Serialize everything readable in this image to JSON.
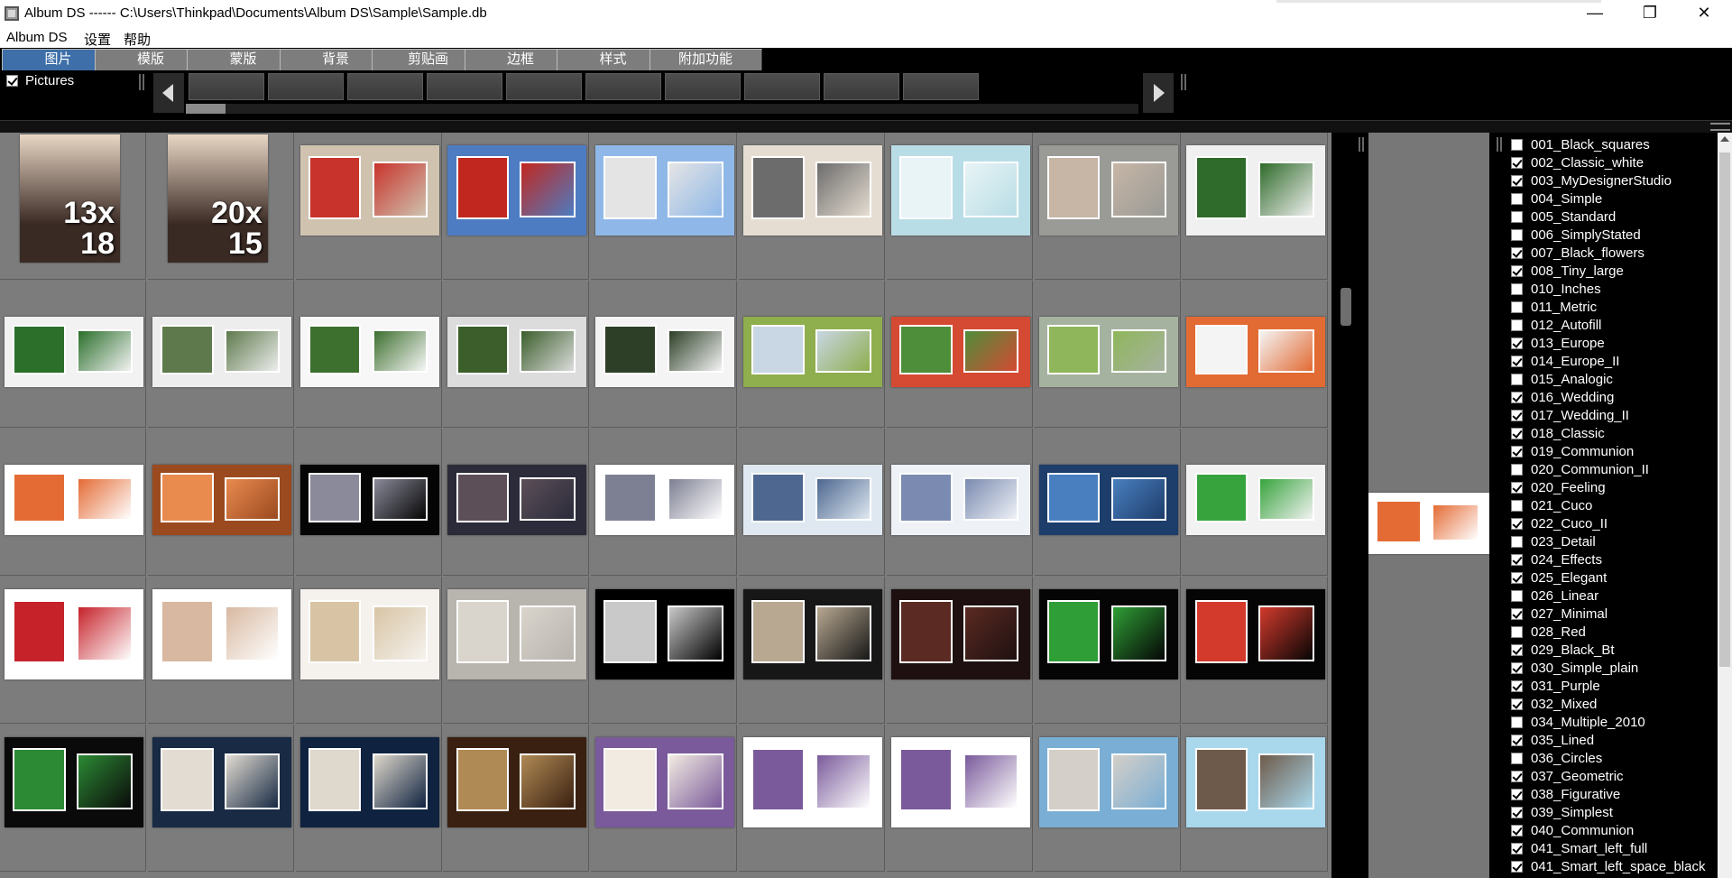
{
  "window": {
    "title": "Album DS ------   C:\\Users\\Thinkpad\\Documents\\Album DS\\Sample\\Sample.db",
    "min_glyph": "—",
    "max_glyph": "❐",
    "close_glyph": "✕"
  },
  "menu": [
    "Album DS",
    "设置",
    "帮助"
  ],
  "tabs": [
    {
      "label": "图片",
      "active": true
    },
    {
      "label": "模版",
      "active": false
    },
    {
      "label": "蒙版",
      "active": false
    },
    {
      "label": "背景",
      "active": false
    },
    {
      "label": "剪贴画",
      "active": false
    },
    {
      "label": "边框",
      "active": false
    },
    {
      "label": "样式",
      "active": false
    },
    {
      "label": "附加功能",
      "active": false
    }
  ],
  "filmstrip": {
    "pictures_label": "Pictures",
    "pictures_checked": true,
    "scroll_position": 0.0
  },
  "grid": {
    "rows": [
      [
        {
          "kind": "size",
          "label": "13x\n18",
          "bg": "#3a2a24",
          "fg": "#e9d7c5"
        },
        {
          "kind": "size",
          "label": "20x\n15",
          "bg": "#3a2a24",
          "fg": "#e9d7c5"
        },
        {
          "kind": "page",
          "bg": "#cfc3b0",
          "accent": "#c8332b"
        },
        {
          "kind": "page",
          "bg": "#4d7cc2",
          "accent": "#c2271f"
        },
        {
          "kind": "page",
          "bg": "#8fb8e8",
          "accent": "#e4e4e4"
        },
        {
          "kind": "page",
          "bg": "#e6ddd2",
          "accent": "#6c6c6c"
        },
        {
          "kind": "page",
          "bg": "#b9dde6",
          "accent": "#e8f4f6"
        },
        {
          "kind": "page",
          "bg": "#9a9a96",
          "accent": "#c7b6a6"
        },
        {
          "kind": "page",
          "bg": "#f0f0f0",
          "accent": "#2f6b2a"
        }
      ],
      [
        {
          "kind": "page",
          "bg": "#f2f2f2",
          "accent": "#2b6f2b"
        },
        {
          "kind": "page",
          "bg": "#ededed",
          "accent": "#5e7a4c"
        },
        {
          "kind": "page",
          "bg": "#f7f7f7",
          "accent": "#3d6f2e"
        },
        {
          "kind": "page",
          "bg": "#dcdcdc",
          "accent": "#3b5e2b"
        },
        {
          "kind": "page",
          "bg": "#f4f4f4",
          "accent": "#2d3f27"
        },
        {
          "kind": "page",
          "bg": "#8fae4e",
          "accent": "#c9d6e4"
        },
        {
          "kind": "page",
          "bg": "#d44a32",
          "accent": "#4e8d3a"
        },
        {
          "kind": "page",
          "bg": "#a6b2a0",
          "accent": "#8fb65a"
        },
        {
          "kind": "page",
          "bg": "#e26a33",
          "accent": "#f4f4f4"
        }
      ],
      [
        {
          "kind": "page",
          "bg": "#ffffff",
          "accent": "#e46b34"
        },
        {
          "kind": "page",
          "bg": "#9b4a1f",
          "accent": "#e98a4f"
        },
        {
          "kind": "page",
          "bg": "#050505",
          "accent": "#8a8a9a"
        },
        {
          "kind": "page",
          "bg": "#2b2b3a",
          "accent": "#5c4f58"
        },
        {
          "kind": "page",
          "bg": "#ffffff",
          "accent": "#7d7f92"
        },
        {
          "kind": "page",
          "bg": "#dfe8f0",
          "accent": "#4d6790"
        },
        {
          "kind": "page",
          "bg": "#eef1f6",
          "accent": "#7a8ab0"
        },
        {
          "kind": "page",
          "bg": "#1d3d6b",
          "accent": "#4a7fbf"
        },
        {
          "kind": "page",
          "bg": "#f2f2f2",
          "accent": "#37a33c"
        }
      ],
      [
        {
          "kind": "page",
          "bg": "#ffffff",
          "accent": "#c5222a"
        },
        {
          "kind": "page",
          "bg": "#ffffff",
          "accent": "#d8b8a0"
        },
        {
          "kind": "page",
          "bg": "#f5f2ee",
          "accent": "#d8c4a4"
        },
        {
          "kind": "page",
          "bg": "#b8b4ae",
          "accent": "#d9d4cc"
        },
        {
          "kind": "page",
          "bg": "#000000",
          "accent": "#c9c9c9"
        },
        {
          "kind": "page",
          "bg": "#171717",
          "accent": "#b8a892"
        },
        {
          "kind": "page",
          "bg": "#1e1010",
          "accent": "#5b2a22"
        },
        {
          "kind": "page",
          "bg": "#050505",
          "accent": "#2f9e36"
        },
        {
          "kind": "page",
          "bg": "#050505",
          "accent": "#d33a2c"
        }
      ],
      [
        {
          "kind": "page",
          "bg": "#0a0a0a",
          "accent": "#2c8a34"
        },
        {
          "kind": "page",
          "bg": "#182a44",
          "accent": "#e2dcd2"
        },
        {
          "kind": "page",
          "bg": "#0f2240",
          "accent": "#dfd8cc"
        },
        {
          "kind": "page",
          "bg": "#3a2010",
          "accent": "#b08a55"
        },
        {
          "kind": "page",
          "bg": "#7a5a9a",
          "accent": "#f2ebe2"
        },
        {
          "kind": "page",
          "bg": "#ffffff",
          "accent": "#7a5a9a"
        },
        {
          "kind": "page",
          "bg": "#ffffff",
          "accent": "#7a5a9a"
        },
        {
          "kind": "page",
          "bg": "#7aaed4",
          "accent": "#d4cfc8"
        },
        {
          "kind": "page",
          "bg": "#a9d8ec",
          "accent": "#6e5a4a"
        }
      ]
    ]
  },
  "preview": {
    "bg": "#ffffff",
    "accent": "#e46b34"
  },
  "grid_scroll_position": 0.22,
  "styles": [
    {
      "name": "001_Black_squares",
      "checked": false
    },
    {
      "name": "002_Classic_white",
      "checked": true
    },
    {
      "name": "003_MyDesignerStudio",
      "checked": true
    },
    {
      "name": "004_Simple",
      "checked": false
    },
    {
      "name": "005_Standard",
      "checked": false
    },
    {
      "name": "006_SimplyStated",
      "checked": false
    },
    {
      "name": "007_Black_flowers",
      "checked": true
    },
    {
      "name": "008_Tiny_large",
      "checked": true
    },
    {
      "name": "010_Inches",
      "checked": false
    },
    {
      "name": "011_Metric",
      "checked": false
    },
    {
      "name": "012_Autofill",
      "checked": false
    },
    {
      "name": "013_Europe",
      "checked": true
    },
    {
      "name": "014_Europe_II",
      "checked": true
    },
    {
      "name": "015_Analogic",
      "checked": false
    },
    {
      "name": "016_Wedding",
      "checked": true
    },
    {
      "name": "017_Wedding_II",
      "checked": true
    },
    {
      "name": "018_Classic",
      "checked": true
    },
    {
      "name": "019_Communion",
      "checked": true
    },
    {
      "name": "020_Communion_II",
      "checked": false
    },
    {
      "name": "020_Feeling",
      "checked": true
    },
    {
      "name": "021_Cuco",
      "checked": false
    },
    {
      "name": "022_Cuco_II",
      "checked": true
    },
    {
      "name": "023_Detail",
      "checked": false
    },
    {
      "name": "024_Effects",
      "checked": true
    },
    {
      "name": "025_Elegant",
      "checked": true
    },
    {
      "name": "026_Linear",
      "checked": false
    },
    {
      "name": "027_Minimal",
      "checked": true
    },
    {
      "name": "028_Red",
      "checked": false
    },
    {
      "name": "029_Black_Bt",
      "checked": true
    },
    {
      "name": "030_Simple_plain",
      "checked": true
    },
    {
      "name": "031_Purple",
      "checked": true
    },
    {
      "name": "032_Mixed",
      "checked": true
    },
    {
      "name": "034_Multiple_2010",
      "checked": false
    },
    {
      "name": "035_Lined",
      "checked": true
    },
    {
      "name": "036_Circles",
      "checked": false
    },
    {
      "name": "037_Geometric",
      "checked": true
    },
    {
      "name": "038_Figurative",
      "checked": true
    },
    {
      "name": "039_Simplest",
      "checked": true
    },
    {
      "name": "040_Communion",
      "checked": true
    },
    {
      "name": "041_Smart_left_full",
      "checked": true
    },
    {
      "name": "041_Smart_left_space_black",
      "checked": true
    }
  ]
}
